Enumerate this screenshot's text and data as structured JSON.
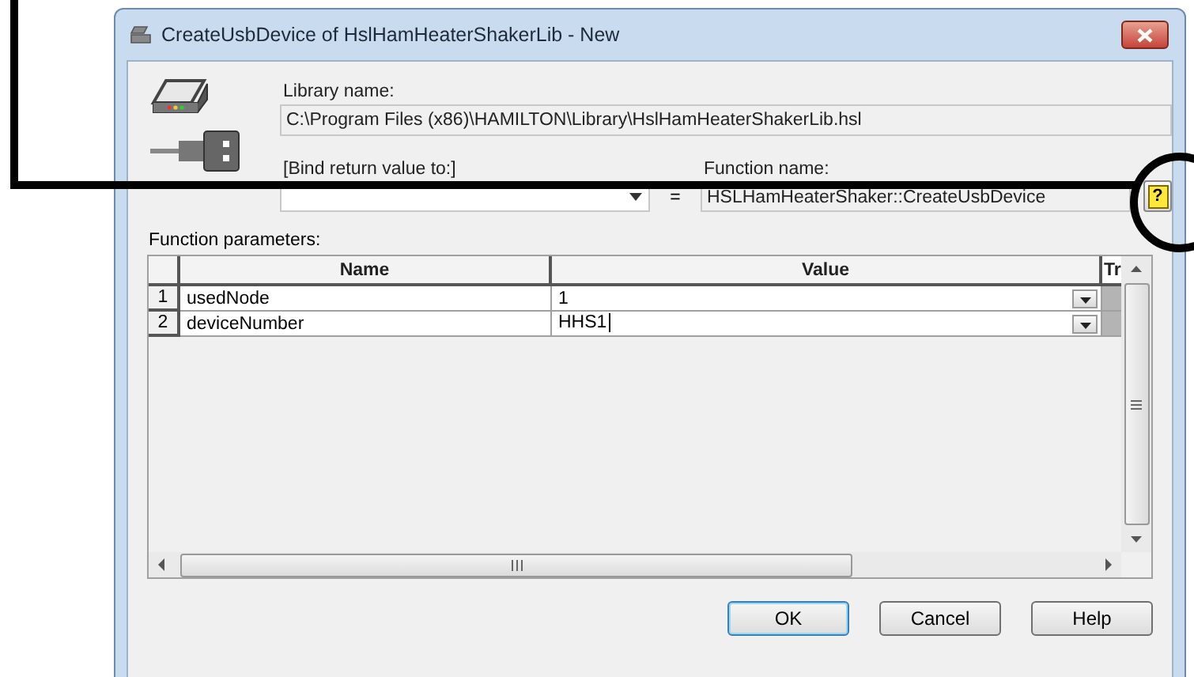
{
  "window": {
    "title": "CreateUsbDevice of HslHamHeaterShakerLib - New"
  },
  "library": {
    "label": "Library name:",
    "value": "C:\\Program Files (x86)\\HAMILTON\\Library\\HslHamHeaterShakerLib.hsl"
  },
  "bind": {
    "label": "[Bind return value to:]"
  },
  "equals": "=",
  "function": {
    "label": "Function name:",
    "value": "HSLHamHeaterShaker::CreateUsbDevice",
    "help": "?"
  },
  "parameters": {
    "label": "Function parameters:",
    "columns": [
      "Name",
      "Value",
      "Tr"
    ],
    "rows": [
      {
        "index": "1",
        "name": "usedNode",
        "value": "1",
        "editing": false
      },
      {
        "index": "2",
        "name": "deviceNumber",
        "value": "HHS1",
        "editing": true
      }
    ]
  },
  "buttons": [
    {
      "label": "OK",
      "default": true
    },
    {
      "label": "Cancel",
      "default": false
    },
    {
      "label": "Help",
      "default": false
    }
  ]
}
